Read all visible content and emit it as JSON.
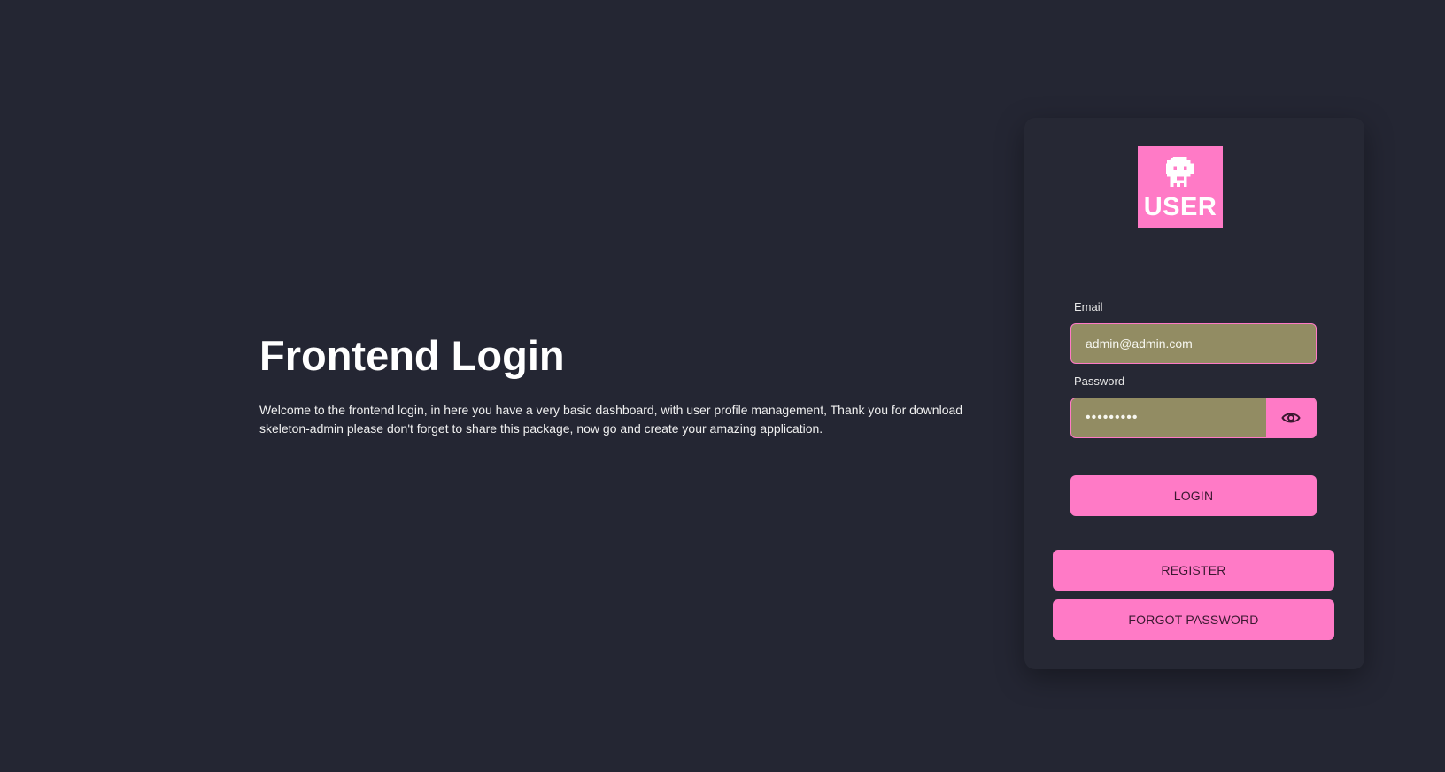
{
  "intro": {
    "title": "Frontend Login",
    "description": "Welcome to the frontend login, in here you have a very basic dashboard, with user profile management, Thank you for download skeleton-admin please don't forget to share this package, now go and create your amazing application."
  },
  "card": {
    "logo": {
      "icon": "skull-icon",
      "text": "USER"
    },
    "email": {
      "label": "Email",
      "value": "admin@admin.com"
    },
    "password": {
      "label": "Password",
      "value": "•••••••••",
      "toggle_icon": "eye-icon"
    },
    "login_label": "LOGIN",
    "register_label": "REGISTER",
    "forgot_label": "FORGOT PASSWORD"
  },
  "colors": {
    "background": "#242633",
    "card": "#262834",
    "accent": "#ff7ac6",
    "input_fill": "#928c63",
    "button_text": "#3a1830"
  }
}
